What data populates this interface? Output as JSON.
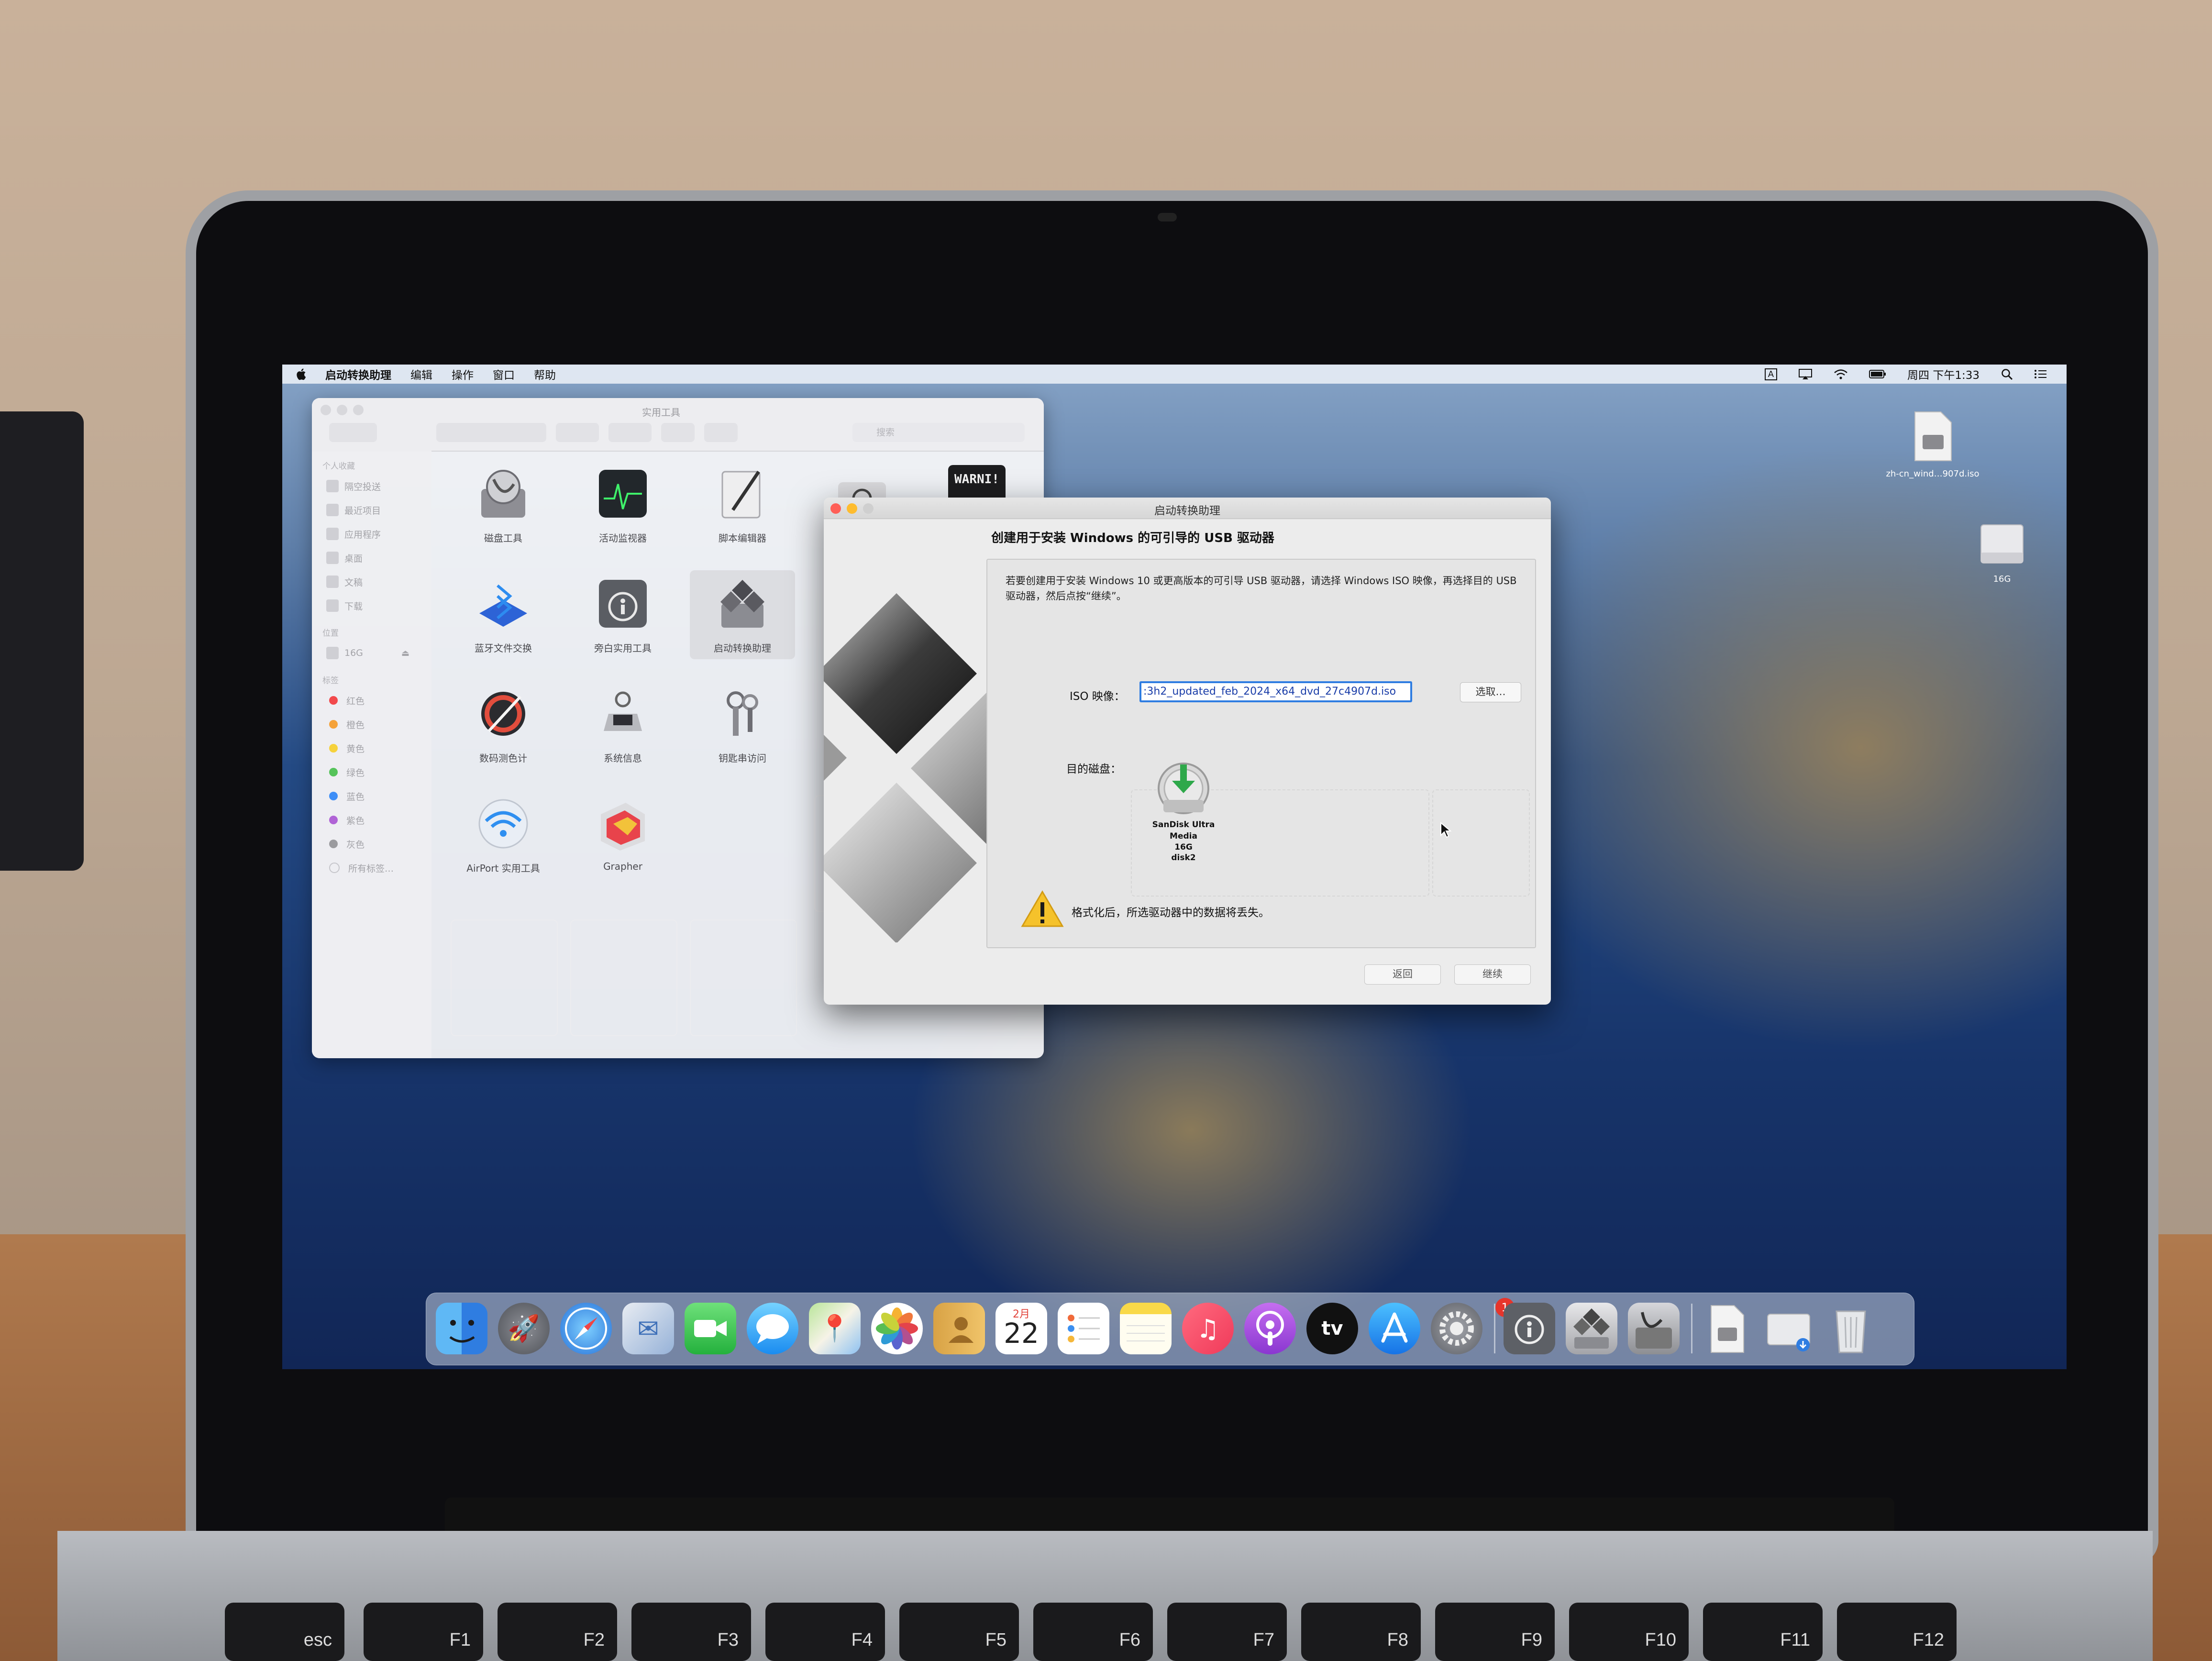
{
  "menubar": {
    "app_name": "启动转换助理",
    "items": [
      "编辑",
      "操作",
      "窗口",
      "帮助"
    ],
    "input_indicator": "A",
    "clock": "周四 下午1:33"
  },
  "desktop": {
    "iso_file_name": "zh-cn_wind…907d.iso",
    "drive_name": "16G"
  },
  "finder": {
    "title": "实用工具",
    "search_placeholder": "搜索",
    "sidebar": {
      "favorites_heading": "个人收藏",
      "favorites": [
        "隔空投送",
        "最近项目",
        "应用程序",
        "桌面",
        "文稿",
        "下载"
      ],
      "locations_heading": "位置",
      "locations": [
        "16G"
      ],
      "tags_heading": "标签",
      "tags": [
        {
          "label": "红色",
          "color": "#f2494c"
        },
        {
          "label": "橙色",
          "color": "#f5a23a"
        },
        {
          "label": "黄色",
          "color": "#f6d23c"
        },
        {
          "label": "绿色",
          "color": "#55c35a"
        },
        {
          "label": "蓝色",
          "color": "#3e8ef7"
        },
        {
          "label": "紫色",
          "color": "#b063d6"
        },
        {
          "label": "灰色",
          "color": "#9b9b9f"
        }
      ],
      "all_tags": "所有标签…"
    },
    "apps": [
      "磁盘工具",
      "活动监视器",
      "脚本编辑器",
      "WARNI!",
      "蓝牙文件交换",
      "旁白实用工具",
      "启动转换助理",
      "数码测色计",
      "系统信息",
      "钥匙串访问",
      "AirPort 实用工具",
      "Grapher"
    ]
  },
  "bootcamp": {
    "window_title": "启动转换助理",
    "heading": "创建用于安装 Windows 的可引导的 USB 驱动器",
    "description": "若要创建用于安装 Windows 10 或更高版本的可引导 USB 驱动器，请选择 Windows ISO 映像，再选择目的 USB 驱动器，然后点按“继续”。",
    "iso_label": "ISO 映像：",
    "iso_value": ":3h2_updated_feb_2024_x64_dvd_27c4907d.iso",
    "choose_button": "选取…",
    "destination_label": "目的磁盘：",
    "disk": {
      "name": "SanDisk Ultra Media",
      "size": "16G",
      "id": "disk2"
    },
    "warning": "格式化后，所选驱动器中的数据将丢失。",
    "back_button": "返回",
    "continue_button": "继续"
  },
  "dock": {
    "calendar_month": "2月",
    "calendar_day": "22",
    "appletv_label": "tv",
    "badge_count": "1"
  },
  "keyboard": {
    "esc": "esc",
    "f1": "F1",
    "f2": "F2",
    "f3": "F3",
    "f4": "F4",
    "f5": "F5",
    "f6": "F6",
    "f7": "F7",
    "f8": "F8",
    "f9": "F9",
    "f10": "F10",
    "f11": "F11",
    "f12": "F12"
  },
  "colors": {
    "accent_blue": "#2f7de1",
    "close": "#ff5f57",
    "minimize": "#febc2e",
    "zoom": "#28c840"
  }
}
